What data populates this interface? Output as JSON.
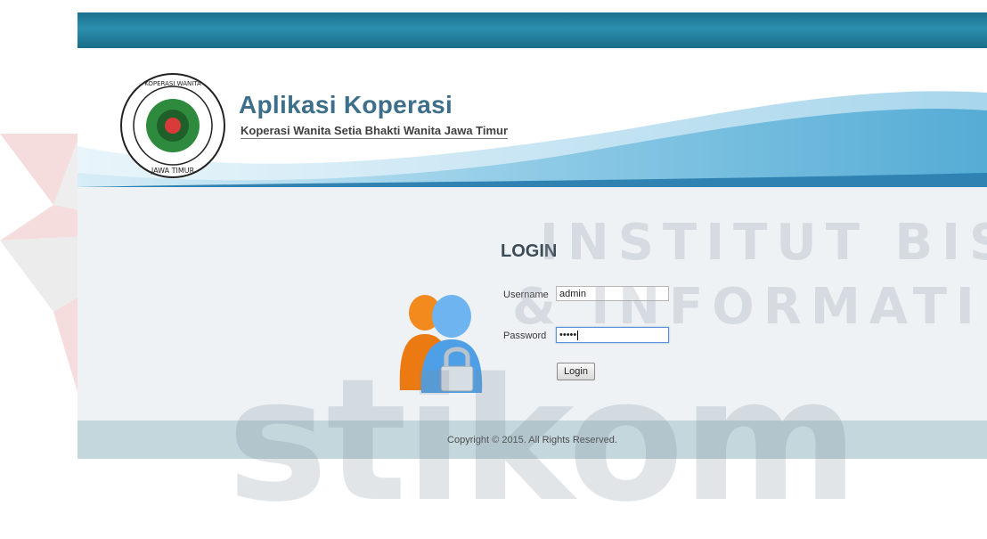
{
  "header": {
    "app_title": "Aplikasi Koperasi",
    "app_subtitle": "Koperasi Wanita Setia Bhakti Wanita Jawa Timur",
    "logo_text_top": "KOPERASI WANITA \"SETIA BHAKTI WANITA\"",
    "logo_text_bottom": "JAWA TIMUR"
  },
  "login": {
    "title": "LOGIN",
    "username_label": "Username",
    "username_value": "admin",
    "password_label": "Password",
    "password_value": "•••••",
    "button_label": "Login"
  },
  "footer": {
    "copyright": "Copyright © 2015. All Rights Reserved."
  },
  "watermark": {
    "line1": "INSTITUT BISNIS",
    "line2": "& INFORMATIKA",
    "line3": "stikom"
  },
  "colors": {
    "topbar": "#1b6f8e",
    "title": "#3d6f8a",
    "content_bg": "#eef2f5",
    "footer_bg": "#c4d7dc",
    "watermark_red": "#e8a0a0"
  }
}
